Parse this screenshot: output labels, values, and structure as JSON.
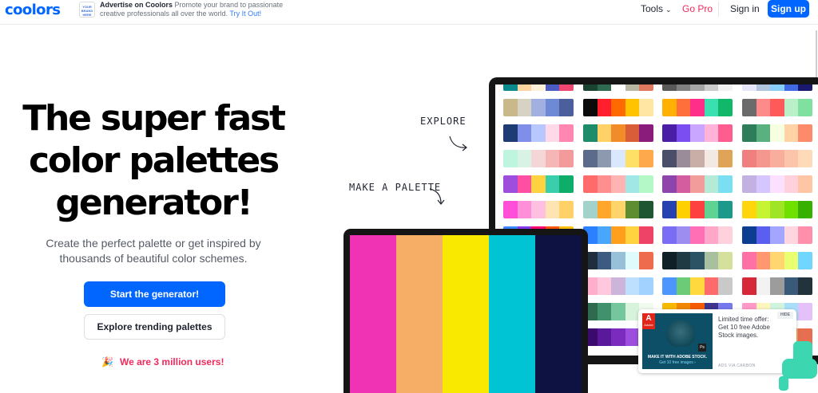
{
  "header": {
    "logo": "coolors",
    "ad": {
      "logo_lines": [
        "YOUR",
        "BRAND",
        "HERE"
      ],
      "title": "Advertise on Coolors",
      "text": "Promote your brand to passionate creative professionals all over the world.",
      "link": "Try It Out!"
    },
    "nav": {
      "tools": "Tools",
      "gopro": "Go Pro",
      "signin": "Sign in",
      "signup": "Sign up"
    }
  },
  "hero": {
    "title_lines": [
      "The super fast",
      "color palettes",
      "generator!"
    ],
    "subtitle": "Create the perfect palette or get inspired by thousands of beautiful color schemes.",
    "primary_button": "Start the generator!",
    "secondary_button": "Explore trending palettes",
    "users": "We are 3 million users!"
  },
  "labels": {
    "explore": "EXPLORE",
    "make_palette": "MAKE A PALETTE"
  },
  "laptop_palette": [
    "#f033b4",
    "#f6ad65",
    "#f9e800",
    "#00c3d3",
    "#0e1243"
  ],
  "explore_palettes": [
    [
      [
        "#0a8a8c",
        "#ffd6a0",
        "#fff0d9",
        "#4b5bc3",
        "#ef476f"
      ],
      [
        "#1b4332",
        "#2d6a4f",
        "#ffffff",
        "#b7b7a4",
        "#e07a5f"
      ],
      [
        "#595959",
        "#7f7f7f",
        "#a5a5a5",
        "#cccccc",
        "#f2f2f2"
      ],
      [
        "#e6e6fa",
        "#b0c4de",
        "#87cefa",
        "#4169e1",
        "#191970"
      ]
    ],
    [
      [
        "#c9b88a",
        "#d7d3c4",
        "#a1b0e0",
        "#6e8ad4",
        "#4a5f9b"
      ],
      [
        "#0b0b0b",
        "#ff1f2d",
        "#ff6a00",
        "#ffc300",
        "#ffe7a3"
      ],
      [
        "#ffb000",
        "#ff6f3c",
        "#ff2e88",
        "#3be0b0",
        "#12b86a"
      ],
      [
        "#6b6b6b",
        "#ff8a8a",
        "#ff5a5a",
        "#b9f0c8",
        "#7fe0a0"
      ]
    ],
    [
      [
        "#1f3b73",
        "#7f8ee8",
        "#b8c8ff",
        "#ffd9e8",
        "#ff87b2"
      ],
      [
        "#1c8c6a",
        "#ffd166",
        "#f28c28",
        "#d95d39",
        "#8a1c7c"
      ],
      [
        "#4b1fa5",
        "#7b4ef2",
        "#c9a6ff",
        "#ffb3d9",
        "#ff5d8f"
      ],
      [
        "#2e7d5b",
        "#5ab07e",
        "#f6ffe0",
        "#ffd3a5",
        "#fd8a6b"
      ]
    ],
    [
      [
        "#bff4df",
        "#d9f2e6",
        "#f5d6d6",
        "#f7b6b6",
        "#f39a9a"
      ],
      [
        "#5c6b8a",
        "#8d99ae",
        "#d9e8ff",
        "#ffe066",
        "#ffa94d"
      ],
      [
        "#4a4e69",
        "#9a8c98",
        "#c9ada7",
        "#f2e9e4",
        "#e0a458"
      ],
      [
        "#f08080",
        "#f4978e",
        "#f8ad9d",
        "#fbc4ab",
        "#ffdab9"
      ]
    ],
    [
      [
        "#9d4edd",
        "#ff4fa2",
        "#ffd23f",
        "#3bceac",
        "#0ead69"
      ],
      [
        "#ff6b6b",
        "#ff8e8e",
        "#ffb3b3",
        "#a0e7e5",
        "#b4f8c8"
      ],
      [
        "#8e44ad",
        "#d35d9e",
        "#f39c9c",
        "#b5ead7",
        "#7bdff2"
      ],
      [
        "#c3b1e1",
        "#d6c6ff",
        "#fbe0ff",
        "#ffd1dc",
        "#ffc6a5"
      ]
    ],
    [
      [
        "#ff4fd8",
        "#ff8fd8",
        "#ffbfe0",
        "#ffe4b3",
        "#ffd166"
      ],
      [
        "#a3d2ca",
        "#ffa62b",
        "#ffd56b",
        "#5e8c31",
        "#1e5631"
      ],
      [
        "#2541b2",
        "#ffd000",
        "#ff4040",
        "#60d394",
        "#1b998b"
      ],
      [
        "#ffd60a",
        "#c6f432",
        "#a0e426",
        "#70e000",
        "#38b000"
      ]
    ],
    [
      [
        "#3a86ff",
        "#8338ec",
        "#ff006e",
        "#fb5607",
        "#ffbe0b"
      ],
      [
        "#2b80ff",
        "#49a6ff",
        "#ff9f1c",
        "#ffd23f",
        "#ee4266"
      ],
      [
        "#7b6cf6",
        "#9d8df1",
        "#ff6fb5",
        "#ffa6c9",
        "#ffd1dc"
      ],
      [
        "#0b3d91",
        "#5b5fef",
        "#a3a6ff",
        "#ffd6e0",
        "#ff8fab"
      ]
    ],
    [
      [
        "#ff5e7e",
        "#ff9a8b",
        "#ffc3a0",
        "#cdb4db",
        "#a2d2ff"
      ],
      [
        "#1f2d3d",
        "#3d5a80",
        "#98c1d9",
        "#e0fbfc",
        "#ee6c4d"
      ],
      [
        "#0f2027",
        "#203a43",
        "#2c5364",
        "#a8c0a0",
        "#d4e09b"
      ],
      [
        "#ff70a6",
        "#ff9770",
        "#ffd670",
        "#e9ff70",
        "#70d6ff"
      ]
    ],
    [
      [
        "#3a7ca5",
        "#81c3d7",
        "#d9dcd6",
        "#f7b267",
        "#f25c54"
      ],
      [
        "#ffafcc",
        "#ffc8dd",
        "#cdb4db",
        "#bde0fe",
        "#a2d2ff"
      ],
      [
        "#4d96ff",
        "#6bcb77",
        "#ffd93d",
        "#ff6b6b",
        "#c9c9c9"
      ],
      [
        "#d62839",
        "#f2f2f2",
        "#9c9c9c",
        "#3a5a7a",
        "#22333b"
      ]
    ],
    [
      [
        "#222831",
        "#393e46",
        "#00adb5",
        "#eeeeee",
        "#ff5722"
      ],
      [
        "#2d6a4f",
        "#40916c",
        "#74c69d",
        "#d8f3dc",
        "#f1faee"
      ],
      [
        "#f7b801",
        "#f18701",
        "#f35b04",
        "#3d348b",
        "#7678ed"
      ],
      [
        "#ff99c8",
        "#fcf6bd",
        "#d0f4de",
        "#a9def9",
        "#e4c1f9"
      ]
    ],
    [
      [
        "#1a1a2e",
        "#16213e",
        "#0f3460",
        "#e94560",
        "#f5f5f5"
      ],
      [
        "#3c096c",
        "#5a189a",
        "#7b2cbf",
        "#9d4edd",
        "#c77dff"
      ],
      [
        "#5bc0eb",
        "#fde74c",
        "#9bc53d",
        "#e55934",
        "#fa7921"
      ],
      [
        "#264653",
        "#2a9d8f",
        "#e9c46a",
        "#f4a261",
        "#e76f51"
      ]
    ]
  ],
  "carbon": {
    "text": "Limited time offer: Get 10 free Adobe Stock images.",
    "hide": "HIDE",
    "via": "ADS VIA CARBON",
    "image_brand": "Adobe",
    "image_caption": "MAKE IT WITH ADOBE STOCK.",
    "image_cta": "Get 10 free images ›"
  },
  "colors": {
    "accent": "#0066ff",
    "pro": "#f2295b",
    "mint": "#3cd6b1"
  }
}
